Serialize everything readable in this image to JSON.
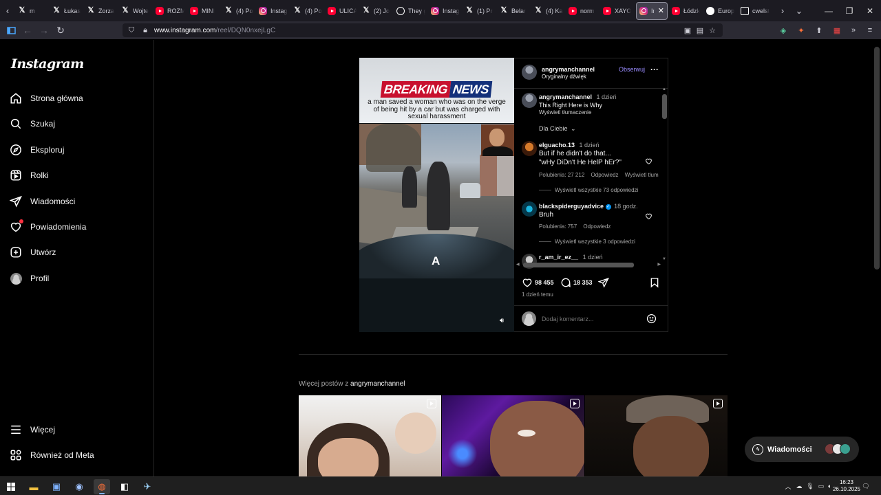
{
  "browser": {
    "tabs": [
      {
        "favicon": "x-icon-partial",
        "label": "m",
        "active": false
      },
      {
        "favicon": "x-logo-icon",
        "label": "Łukas",
        "active": false
      },
      {
        "favicon": "x-logo-icon",
        "label": "Zorza",
        "active": false
      },
      {
        "favicon": "x-logo-icon",
        "label": "Wojte",
        "active": false
      },
      {
        "favicon": "youtube-icon",
        "label": "ROZM",
        "active": false
      },
      {
        "favicon": "youtube-icon",
        "label": "MINI",
        "active": false
      },
      {
        "favicon": "x-logo-icon",
        "label": "(4) Po",
        "active": false
      },
      {
        "favicon": "instagram-icon",
        "label": "Instag",
        "active": false
      },
      {
        "favicon": "x-logo-icon",
        "label": "(4) Po",
        "active": false
      },
      {
        "favicon": "youtube-icon",
        "label": "ULICA",
        "active": false
      },
      {
        "favicon": "x-logo-icon",
        "label": "(2) Jo",
        "active": false
      },
      {
        "favicon": "threads-icon",
        "label": "They g",
        "active": false
      },
      {
        "favicon": "instagram-icon",
        "label": "Instag",
        "active": false
      },
      {
        "favicon": "x-logo-icon",
        "label": "(1) Pr",
        "active": false
      },
      {
        "favicon": "x-logo-icon",
        "label": "Belar",
        "active": false
      },
      {
        "favicon": "x-logo-icon",
        "label": "(4) Ka",
        "active": false
      },
      {
        "favicon": "youtube-icon",
        "label": "norm",
        "active": false
      },
      {
        "favicon": "youtube-icon",
        "label": "XAYO",
        "active": false
      },
      {
        "favicon": "instagram-icon",
        "label": "In",
        "active": true
      },
      {
        "favicon": "youtube-icon",
        "label": "Łódzk",
        "active": false
      },
      {
        "favicon": "globe-icon",
        "label": "Europ",
        "active": false
      },
      {
        "favicon": "table-icon",
        "label": "cwelst",
        "active": false
      }
    ],
    "url_host": "www.instagram.com",
    "url_path": "/reel/DQN0nxejLgC"
  },
  "sidebar": {
    "logo": "Instagram",
    "items": [
      {
        "label": "Strona główna",
        "icon": "home-icon"
      },
      {
        "label": "Szukaj",
        "icon": "search-icon"
      },
      {
        "label": "Eksploruj",
        "icon": "compass-icon"
      },
      {
        "label": "Rolki",
        "icon": "reels-icon"
      },
      {
        "label": "Wiadomości",
        "icon": "paper-plane-icon"
      },
      {
        "label": "Powiadomienia",
        "icon": "heart-icon"
      },
      {
        "label": "Utwórz",
        "icon": "plus-square-icon"
      },
      {
        "label": "Profil",
        "icon": "profile-avatar-icon"
      }
    ],
    "more_label": "Więcej",
    "meta_label": "Również od Meta"
  },
  "reel": {
    "breaking_word1": "BREAKING",
    "breaking_word2": "NEWS",
    "headline": "a man saved a woman who was on the verge of being hit by a car but was charged with sexual harassment",
    "hood_logo": "A"
  },
  "post": {
    "author": "angrymanchannel",
    "audio": "Oryginalny dźwięk",
    "follow_label": "Obserwuj",
    "caption": {
      "author": "angrymanchannel",
      "time": "1 dzień",
      "text": "This Right Here is Why",
      "translate": "Wyświetl tłumaczenie"
    },
    "filter_label": "Dla Ciebie",
    "comments": [
      {
        "author": "elguacho.13",
        "time": "1 dzień",
        "text_line1": "But if he didn't do that...",
        "text_line2": "\"wHy DiDn't He HelP hEr?\"",
        "likes": "Polubienia: 27 212",
        "reply": "Odpowiedz",
        "translate": "Wyświetl tłum",
        "view_replies": "Wyświetl wszystkie 73 odpowiedzi"
      },
      {
        "author": "blackspiderguyadvice",
        "verified": true,
        "time": "18 godz.",
        "text_line1": "Bruh",
        "likes": "Polubienia: 757",
        "reply": "Odpowiedz",
        "view_replies": "Wyświetl wszystkie 3 odpowiedzi"
      },
      {
        "author": "r_am_ir_ez__",
        "time": "1 dzień"
      }
    ],
    "like_count": "98 455",
    "comment_count": "18 353",
    "posted": "1 dzień temu",
    "comment_placeholder": "Dodaj komentarz..."
  },
  "more_posts": {
    "prefix": "Więcej postów z ",
    "author": "angrymanchannel"
  },
  "messages_pill": {
    "label": "Wiadomości"
  },
  "taskbar": {
    "time": "16:23",
    "date": "26.10.2025"
  },
  "colors": {
    "ig_blue_link": "#9a8cff",
    "notification_dot": "#ff3040",
    "breaking_red": "#c8102e",
    "breaking_blue": "#13307a"
  }
}
